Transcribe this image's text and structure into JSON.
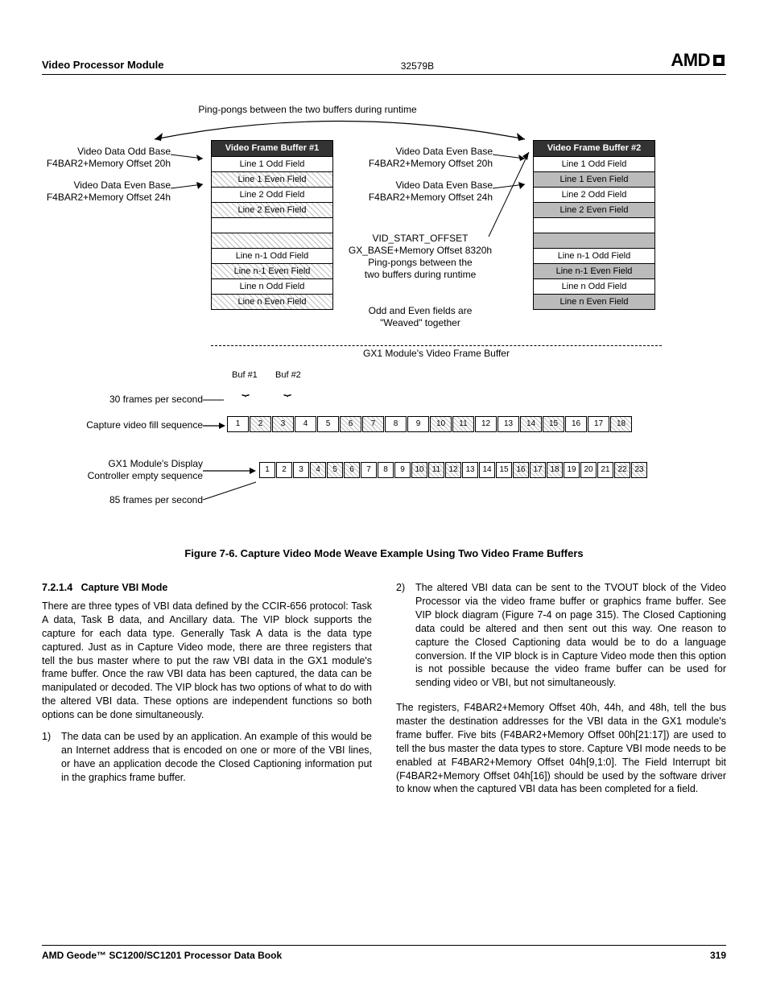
{
  "header": {
    "left": "Video Processor Module",
    "doc_num": "32579B",
    "logo": "AMD"
  },
  "fig": {
    "ping_caption": "Ping-pongs between the two buffers during runtime",
    "odd_base_1": "Video Data Odd Base",
    "odd_base_2": "F4BAR2+Memory Offset 20h",
    "even_base_1": "Video Data Even Base",
    "even_base_2": "F4BAR2+Memory Offset 24h",
    "even_base_r1": "Video Data Even Base",
    "even_base_r2": "F4BAR2+Memory Offset 20h",
    "even_base_r3": "Video Data Even Base",
    "even_base_r4": "F4BAR2+Memory Offset 24h",
    "vid_start_1": "VID_START_OFFSET",
    "vid_start_2": "GX_BASE+Memory Offset 8320h",
    "vid_start_3": "Ping-pongs between the",
    "vid_start_4": "two buffers during runtime",
    "weave_1": "Odd and Even fields are",
    "weave_2": "\"Weaved\" together",
    "gx1_buf": "GX1 Module's Video Frame Buffer",
    "buf1_title": "Video Frame Buffer #1",
    "buf2_title": "Video Frame Buffer #2",
    "rows": [
      "Line 1 Odd Field",
      "Line 1 Even Field",
      "Line 2 Odd Field",
      "Line 2 Even Field",
      "",
      "",
      "Line n-1 Odd Field",
      "Line n-1 Even Field",
      "Line n Odd Field",
      "Line n Even Field"
    ],
    "buf1_lbl": "Buf #1",
    "buf2_lbl": "Buf #2",
    "fps30": "30 frames per second",
    "cap_seq": "Capture video fill sequence",
    "disp_seq_1": "GX1 Module's Display",
    "disp_seq_2": "Controller empty sequence",
    "fps85": "85 frames per second",
    "seq1": [
      "1",
      "2",
      "3",
      "4",
      "5",
      "6",
      "7",
      "8",
      "9",
      "10",
      "11",
      "12",
      "13",
      "14",
      "15",
      "16",
      "17",
      "18"
    ],
    "seq2": [
      "1",
      "2",
      "3",
      "4",
      "5",
      "6",
      "7",
      "8",
      "9",
      "10",
      "11",
      "12",
      "13",
      "14",
      "15",
      "16",
      "17",
      "18",
      "19",
      "20",
      "21",
      "22",
      "23"
    ]
  },
  "caption": "Figure 7-6.  Capture Video Mode Weave Example Using Two Video Frame Buffers",
  "body": {
    "sect_num": "7.2.1.4",
    "sect_title": "Capture VBI Mode",
    "p1": "There are three types of VBI data defined by the CCIR-656 protocol: Task A data, Task B data, and Ancillary data. The VIP block supports the capture for each data type. Generally Task A data is the data type captured. Just as in Capture Video mode, there are three registers that tell the bus master where to put the raw VBI data in the GX1 module's frame buffer. Once the raw VBI data has been captured, the data can be manipulated or decoded. The VIP block has two options of what to do with the altered VBI data. These options are independent functions so both options can be done simultaneously.",
    "li1": "The data can be used by an application. An example of this would be an Internet address that is encoded on one or more of the VBI lines, or have an application decode the Closed Captioning information put in the graphics frame buffer.",
    "li2": "The altered VBI data can be sent to the TVOUT block of the Video Processor via the video frame buffer or graphics frame buffer. See VIP block diagram (Figure 7-4 on page 315). The Closed Captioning data could be altered and then sent out this way. One reason to capture the Closed Captioning data would be to do a language conversion. If the VIP block is in Capture Video mode then this option is not possible because the video frame buffer can be used for sending video or VBI, but not simultaneously.",
    "p2": "The registers, F4BAR2+Memory Offset 40h, 44h, and 48h, tell the bus master the destination addresses for the VBI data in the GX1 module's frame buffer. Five bits (F4BAR2+Memory Offset 00h[21:17]) are used to tell the bus master the data types to store. Capture VBI mode needs to be enabled at F4BAR2+Memory Offset 04h[9,1:0]. The Field Interrupt bit (F4BAR2+Memory Offset 04h[16]) should be used by the software driver to know when the captured VBI data has been completed for a field."
  },
  "footer": {
    "title": "AMD Geode™ SC1200/SC1201 Processor Data Book",
    "page": "319"
  }
}
